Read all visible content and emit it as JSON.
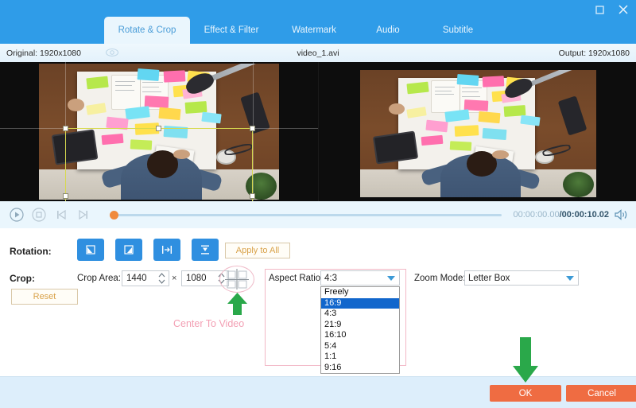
{
  "window": {
    "controls": [
      {
        "name": "maximize-button",
        "icon": "maximize-icon",
        "label": ""
      },
      {
        "name": "close-button",
        "icon": "close-icon",
        "label": ""
      }
    ]
  },
  "tabs": [
    {
      "label": "Rotate & Crop",
      "active": true
    },
    {
      "label": "Effect & Filter",
      "active": false
    },
    {
      "label": "Watermark",
      "active": false
    },
    {
      "label": "Audio",
      "active": false
    },
    {
      "label": "Subtitle",
      "active": false
    }
  ],
  "info": {
    "original": "Original: 1920x1080",
    "filename": "video_1.avi",
    "output": "Output: 1920x1080",
    "eye_icon": "eye-icon"
  },
  "transport": {
    "play_icon": "play-icon",
    "stop_icon": "stop-icon",
    "prev_icon": "previous-frame-icon",
    "next_icon": "next-frame-icon",
    "volume_icon": "volume-icon",
    "current_time": "00:00:00.00",
    "separator": "/",
    "total_time": "00:00:10.02",
    "progress_percent": 0
  },
  "rotation": {
    "label": "Rotation:",
    "buttons": [
      {
        "name": "rotate-left-button",
        "icon": "rotate-left-icon"
      },
      {
        "name": "rotate-right-button",
        "icon": "rotate-right-icon"
      },
      {
        "name": "flip-horizontal-button",
        "icon": "flip-horizontal-icon"
      },
      {
        "name": "flip-vertical-button",
        "icon": "flip-vertical-icon"
      }
    ],
    "apply_to_all": "Apply to All"
  },
  "crop": {
    "label": "Crop:",
    "reset": "Reset",
    "crop_area_label": "Crop Area:",
    "width": "1440",
    "height": "1080",
    "times": "×",
    "center_icon": "center-to-video-icon",
    "center_caption": "Center To Video"
  },
  "aspect_ratio": {
    "label": "Aspect Ratio:",
    "selected": "4:3",
    "options": [
      "Freely",
      "16:9",
      "4:3",
      "21:9",
      "16:10",
      "5:4",
      "1:1",
      "9:16"
    ],
    "highlighted": "16:9"
  },
  "zoom_mode": {
    "label": "Zoom Mode:",
    "selected": "Letter Box"
  },
  "footer": {
    "ok": "OK",
    "cancel": "Cancel"
  },
  "colors": {
    "accent_blue": "#2f9ce8",
    "panel_blue": "#eaf6fd",
    "footer_blue": "#ddeefb",
    "button_orange": "#ef6c42",
    "annotation_pink": "#f3a0b4",
    "annotation_green": "#2aa84a",
    "select_highlight": "#1166cc",
    "crop_border": "#d7d94f"
  }
}
